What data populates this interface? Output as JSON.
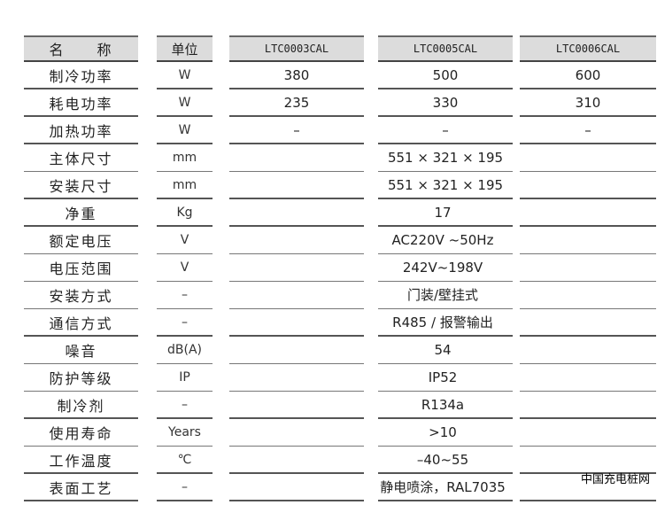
{
  "header": {
    "name": "名　　称",
    "unit": "单位",
    "models": [
      "LTC0003CAL",
      "LTC0005CAL",
      "LTC0006CAL"
    ]
  },
  "rows": [
    {
      "name": "制冷功率",
      "unit": "W",
      "values": [
        "380",
        "500",
        "600"
      ]
    },
    {
      "name": "耗电功率",
      "unit": "W",
      "values": [
        "235",
        "330",
        "310"
      ]
    },
    {
      "name": "加热功率",
      "unit": "W",
      "values": [
        "–",
        "–",
        "–"
      ]
    },
    {
      "name": "主体尺寸",
      "unit": "mm",
      "values": [
        "",
        "551 × 321 × 195",
        ""
      ]
    },
    {
      "name": "安装尺寸",
      "unit": "mm",
      "values": [
        "",
        "551 × 321 × 195",
        ""
      ]
    },
    {
      "name": "净重",
      "unit": "Kg",
      "span_value": "17"
    },
    {
      "name": "额定电压",
      "unit": "V",
      "span_value": "AC220V ~50Hz"
    },
    {
      "name": "电压范围",
      "unit": "V",
      "span_value": "242V~198V"
    },
    {
      "name": "安装方式",
      "unit": "–",
      "span_value": "门装/壁挂式"
    },
    {
      "name": "通信方式",
      "unit": "–",
      "span_value": "R485 / 报警输出"
    },
    {
      "name": "噪音",
      "unit": "dB(A)",
      "span_value": "54"
    },
    {
      "name": "防护等级",
      "unit": "IP",
      "span_value": "IP52"
    },
    {
      "name": "制冷剂",
      "unit": "–",
      "span_value": "R134a"
    },
    {
      "name": "使用寿命",
      "unit": "Years",
      "span_value": ">10"
    },
    {
      "name": "工作温度",
      "unit": "℃",
      "span_value": "–40~55"
    },
    {
      "name": "表面工艺",
      "unit": "–",
      "span_value": "静电喷涂，RAL7035"
    }
  ],
  "watermark": "中国充电桩网"
}
